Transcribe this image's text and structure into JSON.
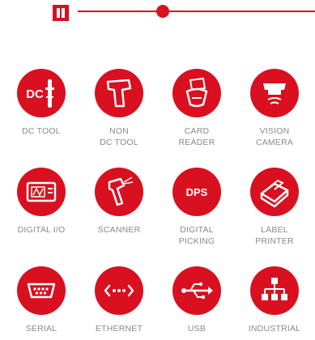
{
  "player": {
    "progress": 0.36,
    "accent_color": "#d9101f",
    "pause_icon": "pause-icon"
  },
  "categories": [
    {
      "label": "DC TOOL",
      "icon": "dc-tool-icon",
      "icon_text": "DC"
    },
    {
      "label": "NON\nDC TOOL",
      "icon": "non-dc-tool-icon"
    },
    {
      "label": "CARD\nREADER",
      "icon": "card-reader-icon"
    },
    {
      "label": "VISION\nCAMERA",
      "icon": "vision-camera-icon"
    },
    {
      "label": "DIGITAL I/O",
      "icon": "digital-io-icon"
    },
    {
      "label": "SCANNER",
      "icon": "scanner-icon"
    },
    {
      "label": "DIGITAL\nPICKING",
      "icon": "digital-picking-icon",
      "icon_text": "DPS"
    },
    {
      "label": "LABEL\nPRINTER",
      "icon": "label-printer-icon"
    },
    {
      "label": "SERIAL",
      "icon": "serial-port-icon"
    },
    {
      "label": "ETHERNET",
      "icon": "ethernet-icon"
    },
    {
      "label": "USB",
      "icon": "usb-icon"
    },
    {
      "label": "INDUSTRIAL",
      "icon": "industrial-network-icon"
    }
  ]
}
